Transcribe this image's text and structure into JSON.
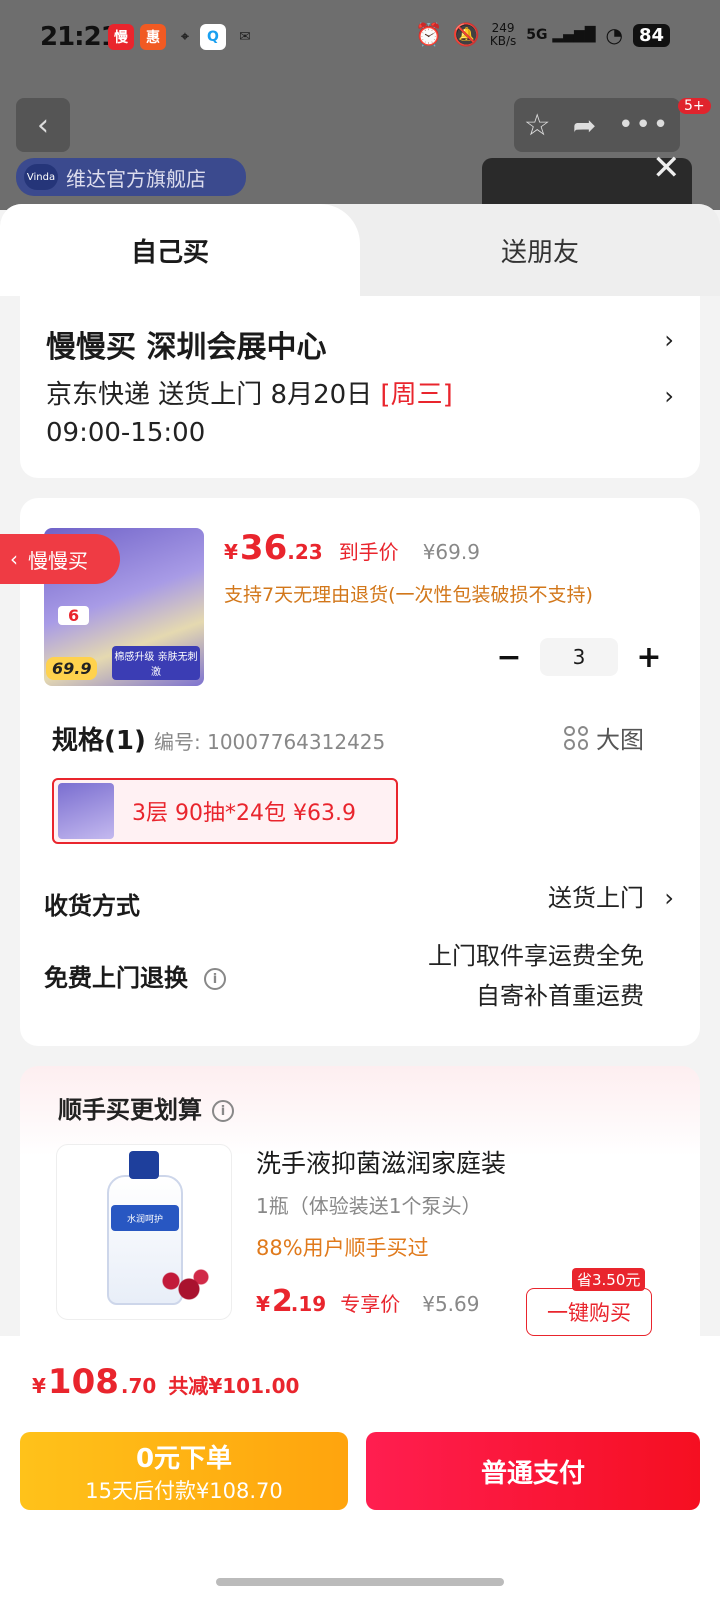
{
  "status": {
    "time": "21:21",
    "speed_value": "249",
    "speed_unit": "KB/s",
    "network": "5G",
    "battery": "84",
    "apps": [
      {
        "label": "慢",
        "color": "#e9252d"
      },
      {
        "label": "惠",
        "color": "#f15a22"
      },
      {
        "label": "⌖",
        "color": "#444"
      },
      {
        "label": "Q",
        "color": "#1aa0f0"
      },
      {
        "label": "✉",
        "color": "#222"
      }
    ]
  },
  "header": {
    "badge": "5+",
    "store_name": "维达官方旗舰店",
    "store_logo": "Vinda"
  },
  "tabs": {
    "self": "自己买",
    "gift": "送朋友"
  },
  "address": {
    "title": "慢慢买  深圳会展中心",
    "delivery_line1": "京东快递 送货上门 8月20日",
    "delivery_weekday": "[周三]",
    "delivery_line2": "09:00-15:00"
  },
  "product": {
    "side_tag": "慢慢买",
    "img_tag_price": "69.9",
    "img_tag_six": "6",
    "img_tag_text": "棉感升级 亲肤无刺激",
    "yen": "¥",
    "price_int": "36",
    "price_dec": ".23",
    "price_label": "到手价",
    "orig_price": "¥69.9",
    "returns": "支持7天无理由退货(一次性包装破损不支持)",
    "qty": "3",
    "minus": "−",
    "plus": "+"
  },
  "spec": {
    "title": "规格(1)",
    "number": "编号: 100077643124​25",
    "big_pic": "大图",
    "sku_text": "3层 90抽*24包   ¥63.9"
  },
  "shipping": {
    "label": "收货方式",
    "value": "送货上门"
  },
  "returns_row": {
    "label": "免费上门退换",
    "line1": "上门取件享运费全免",
    "line2": "自寄补首重运费"
  },
  "upsell": {
    "title": "顺手买更划算",
    "name": "洗手液抑菌滋润家庭装",
    "spec": "1瓶（体验装送1个泵头）",
    "buyers": "88%用户顺手买过",
    "yen": "¥",
    "price_int": "2",
    "price_dec": ".19",
    "price_label": "专享价",
    "orig_price": "¥5.69",
    "save_tag": "省3.50元",
    "button": "一键购买",
    "bottle_label": "水润呵护"
  },
  "bottom": {
    "yen": "¥",
    "total_int": "108",
    "total_dec": ".70",
    "reduce": "共减¥101.00",
    "zero_l1": "0元下单",
    "zero_l2": "15天后付款¥108.70",
    "pay": "普通支付"
  },
  "colors": {
    "accent": "#e9252d",
    "orange": "#d2771a",
    "yellow_btn": "#ffb20f",
    "red_btn": "#fa1636"
  }
}
